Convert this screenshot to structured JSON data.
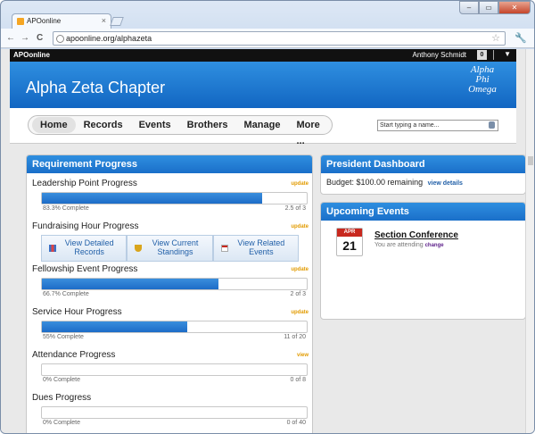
{
  "browser": {
    "tab_title": "APOonline",
    "tab_close": "×",
    "url": "apoonline.org/alphazeta",
    "back": "←",
    "forward": "→",
    "reload": "C",
    "minimize": "–",
    "maximize": "▭",
    "close": "✕"
  },
  "topbar": {
    "brand": "APOonline",
    "user": "Anthony Schmidt",
    "count": "0",
    "menu_arrow": "▼"
  },
  "header": {
    "title": "Alpha Zeta Chapter",
    "crest_line1": "Alpha",
    "crest_line2": "Phi",
    "crest_line3": "Omega"
  },
  "nav": {
    "items": [
      "Home",
      "Records",
      "Events",
      "Brothers",
      "Manage",
      "More ..."
    ],
    "active": "Home",
    "search_placeholder": "Start typing a name..."
  },
  "requirements": {
    "title": "Requirement Progress",
    "rows": [
      {
        "title": "Leadership Point Progress",
        "action": "update",
        "progress": 0.833,
        "pct": "83.3% Complete",
        "of": "2.5 of 3"
      },
      {
        "title": "Fundraising Hour Progress",
        "action": "update"
      },
      {
        "title": "Fellowship Event Progress",
        "action": "update",
        "progress": 0.667,
        "pct": "66.7% Complete",
        "of": "2 of 3"
      },
      {
        "title": "Service Hour Progress",
        "action": "update",
        "progress": 0.55,
        "pct": "55% Complete",
        "of": "11 of 20"
      },
      {
        "title": "Attendance Progress",
        "action": "view",
        "progress": 0,
        "pct": "0% Complete",
        "of": "0 of 8"
      },
      {
        "title": "Dues Progress",
        "action": "",
        "progress": 0,
        "pct": "0% Complete",
        "of": "0 of 40"
      }
    ],
    "buttons": [
      {
        "line1": "View Detailed",
        "line2": "Records"
      },
      {
        "line1": "View Current",
        "line2": "Standings"
      },
      {
        "line1": "View Related",
        "line2": "Events"
      }
    ]
  },
  "president": {
    "title": "President Dashboard",
    "budget": "Budget: $100.00 remaining",
    "link": "view details"
  },
  "events": {
    "title": "Upcoming Events",
    "month": "APR",
    "day": "21",
    "name": "Section Conference",
    "status": "You are attending",
    "change": "change"
  },
  "colors": {
    "accent": "#1a6fc9",
    "update": "#e29b00",
    "calendar": "#c8281e"
  }
}
